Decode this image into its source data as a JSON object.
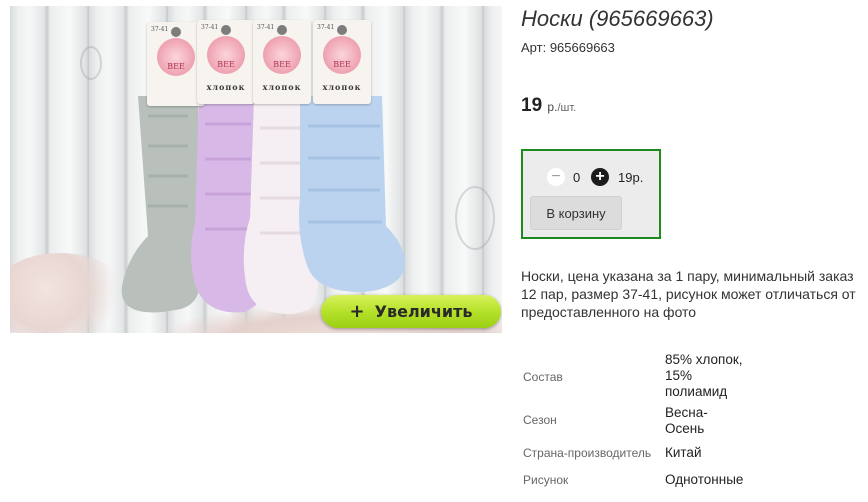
{
  "product": {
    "title": "Носки (965669663)",
    "sku_label": "Арт:",
    "sku_value": "965669663",
    "price_value": "19",
    "price_unit": "р.",
    "price_per": "/шт.",
    "description": "Носки, цена указана за 1 пару, минимальный заказ 12 пар, размер 37-41, рисунок может отличаться от предоставленного на фото"
  },
  "photo": {
    "zoom_label": "Увеличить",
    "zoom_icon": "plus-icon",
    "tag_size": "37-41",
    "tag_brand": "BEE",
    "tag_word": "хлопок"
  },
  "cart": {
    "quantity": "0",
    "line_total": "19р.",
    "add_label": "В корзину",
    "minus_icon": "minus-icon",
    "plus_icon": "plus-icon",
    "border_color": "#1e8a1e"
  },
  "specs": [
    {
      "label": "Состав",
      "value": "85% хлопок, 15% полиамид"
    },
    {
      "label": "Сезон",
      "value": "Весна-Осень"
    },
    {
      "label": "Страна-производитель",
      "value": "Китай"
    },
    {
      "label": "Рисунок",
      "value": "Однотонные"
    }
  ]
}
